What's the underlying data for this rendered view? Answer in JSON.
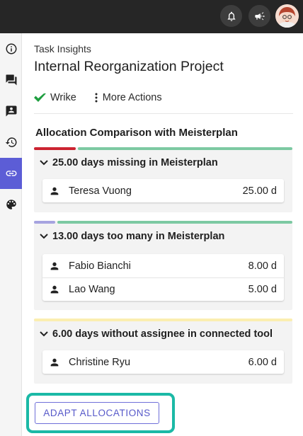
{
  "topbar": {
    "icons": [
      "bell-icon",
      "megaphone-icon"
    ],
    "avatar": "avatar"
  },
  "sidebar": {
    "items": [
      {
        "icon": "info-icon",
        "active": false
      },
      {
        "icon": "chat-icon",
        "active": false
      },
      {
        "icon": "contact-card-icon",
        "active": false
      },
      {
        "icon": "history-icon",
        "active": false
      },
      {
        "icon": "link-icon",
        "active": true
      },
      {
        "icon": "palette-icon",
        "active": false
      }
    ],
    "active_color": "#5c5dd6"
  },
  "header": {
    "subtitle": "Task Insights",
    "title": "Internal Reorganization Project"
  },
  "actions": {
    "wrike_label": "Wrike",
    "more_label": "More Actions"
  },
  "section": {
    "title": "Allocation Comparison with Meisterplan"
  },
  "groups": [
    {
      "title": "25.00 days missing in Meisterplan",
      "bar_colors": [
        "#cc2331",
        "#7cc9a2"
      ],
      "rows": [
        {
          "name": "Teresa Vuong",
          "days": "25.00 d"
        }
      ]
    },
    {
      "title": "13.00 days too many in Meisterplan",
      "bar_colors": [
        "#a6a3e0",
        "#7cc9a2"
      ],
      "rows": [
        {
          "name": "Fabio Bianchi",
          "days": "8.00 d"
        },
        {
          "name": "Lao Wang",
          "days": "5.00 d"
        }
      ]
    },
    {
      "title": "6.00 days without assignee in connected tool",
      "bar_colors": [
        "#fbeeb0"
      ],
      "rows": [
        {
          "name": "Christine Ryu",
          "days": "6.00 d"
        }
      ]
    }
  ],
  "footer": {
    "adapt_label": "ADAPT ALLOCATIONS",
    "highlight_color": "#1bb9a6"
  }
}
